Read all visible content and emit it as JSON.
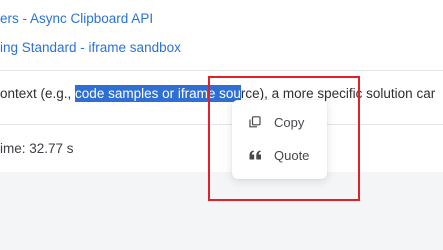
{
  "links": [
    {
      "text": "ers - Async Clipboard API"
    },
    {
      "text": "ing Standard - iframe sandbox"
    }
  ],
  "paragraph": {
    "before": "ontext (e.g., ",
    "selected": "code samples or iframe sou",
    "after": "rce), a more specific solution car"
  },
  "time_text": "ime: 32.77 s",
  "selection_menu": {
    "items": [
      {
        "label": "Copy",
        "icon": "copy-icon"
      },
      {
        "label": "Quote",
        "icon": "quote-icon"
      }
    ]
  },
  "colors": {
    "link": "#2b72d6",
    "selection": "#2f6fd3",
    "annotation_box": "#e0202a"
  }
}
